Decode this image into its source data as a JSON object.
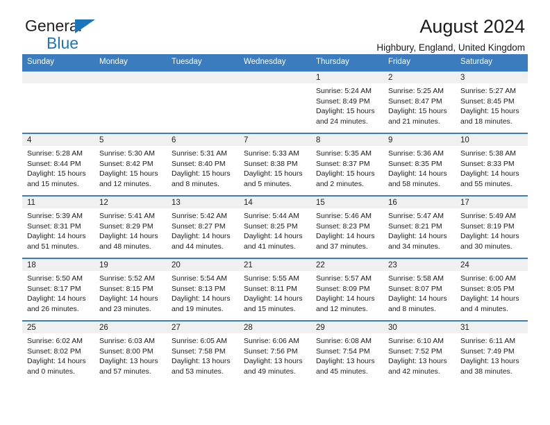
{
  "brand": {
    "line1": "General",
    "line2": "Blue",
    "triangle_color": "#1b75bb",
    "text_color": "#231f20"
  },
  "header": {
    "title": "August 2024",
    "subtitle": "Highbury, England, United Kingdom"
  },
  "theme": {
    "header_blue": "#3a7cbe",
    "daynum_band": "#f0f0f0",
    "text": "#1a1a1a"
  },
  "weekday_headers": [
    "Sunday",
    "Monday",
    "Tuesday",
    "Wednesday",
    "Thursday",
    "Friday",
    "Saturday"
  ],
  "weeks": [
    [
      {
        "day": "",
        "sunrise": "",
        "sunset": "",
        "daylight1": "",
        "daylight2": ""
      },
      {
        "day": "",
        "sunrise": "",
        "sunset": "",
        "daylight1": "",
        "daylight2": ""
      },
      {
        "day": "",
        "sunrise": "",
        "sunset": "",
        "daylight1": "",
        "daylight2": ""
      },
      {
        "day": "",
        "sunrise": "",
        "sunset": "",
        "daylight1": "",
        "daylight2": ""
      },
      {
        "day": "1",
        "sunrise": "Sunrise: 5:24 AM",
        "sunset": "Sunset: 8:49 PM",
        "daylight1": "Daylight: 15 hours",
        "daylight2": "and 24 minutes."
      },
      {
        "day": "2",
        "sunrise": "Sunrise: 5:25 AM",
        "sunset": "Sunset: 8:47 PM",
        "daylight1": "Daylight: 15 hours",
        "daylight2": "and 21 minutes."
      },
      {
        "day": "3",
        "sunrise": "Sunrise: 5:27 AM",
        "sunset": "Sunset: 8:45 PM",
        "daylight1": "Daylight: 15 hours",
        "daylight2": "and 18 minutes."
      }
    ],
    [
      {
        "day": "4",
        "sunrise": "Sunrise: 5:28 AM",
        "sunset": "Sunset: 8:44 PM",
        "daylight1": "Daylight: 15 hours",
        "daylight2": "and 15 minutes."
      },
      {
        "day": "5",
        "sunrise": "Sunrise: 5:30 AM",
        "sunset": "Sunset: 8:42 PM",
        "daylight1": "Daylight: 15 hours",
        "daylight2": "and 12 minutes."
      },
      {
        "day": "6",
        "sunrise": "Sunrise: 5:31 AM",
        "sunset": "Sunset: 8:40 PM",
        "daylight1": "Daylight: 15 hours",
        "daylight2": "and 8 minutes."
      },
      {
        "day": "7",
        "sunrise": "Sunrise: 5:33 AM",
        "sunset": "Sunset: 8:38 PM",
        "daylight1": "Daylight: 15 hours",
        "daylight2": "and 5 minutes."
      },
      {
        "day": "8",
        "sunrise": "Sunrise: 5:35 AM",
        "sunset": "Sunset: 8:37 PM",
        "daylight1": "Daylight: 15 hours",
        "daylight2": "and 2 minutes."
      },
      {
        "day": "9",
        "sunrise": "Sunrise: 5:36 AM",
        "sunset": "Sunset: 8:35 PM",
        "daylight1": "Daylight: 14 hours",
        "daylight2": "and 58 minutes."
      },
      {
        "day": "10",
        "sunrise": "Sunrise: 5:38 AM",
        "sunset": "Sunset: 8:33 PM",
        "daylight1": "Daylight: 14 hours",
        "daylight2": "and 55 minutes."
      }
    ],
    [
      {
        "day": "11",
        "sunrise": "Sunrise: 5:39 AM",
        "sunset": "Sunset: 8:31 PM",
        "daylight1": "Daylight: 14 hours",
        "daylight2": "and 51 minutes."
      },
      {
        "day": "12",
        "sunrise": "Sunrise: 5:41 AM",
        "sunset": "Sunset: 8:29 PM",
        "daylight1": "Daylight: 14 hours",
        "daylight2": "and 48 minutes."
      },
      {
        "day": "13",
        "sunrise": "Sunrise: 5:42 AM",
        "sunset": "Sunset: 8:27 PM",
        "daylight1": "Daylight: 14 hours",
        "daylight2": "and 44 minutes."
      },
      {
        "day": "14",
        "sunrise": "Sunrise: 5:44 AM",
        "sunset": "Sunset: 8:25 PM",
        "daylight1": "Daylight: 14 hours",
        "daylight2": "and 41 minutes."
      },
      {
        "day": "15",
        "sunrise": "Sunrise: 5:46 AM",
        "sunset": "Sunset: 8:23 PM",
        "daylight1": "Daylight: 14 hours",
        "daylight2": "and 37 minutes."
      },
      {
        "day": "16",
        "sunrise": "Sunrise: 5:47 AM",
        "sunset": "Sunset: 8:21 PM",
        "daylight1": "Daylight: 14 hours",
        "daylight2": "and 34 minutes."
      },
      {
        "day": "17",
        "sunrise": "Sunrise: 5:49 AM",
        "sunset": "Sunset: 8:19 PM",
        "daylight1": "Daylight: 14 hours",
        "daylight2": "and 30 minutes."
      }
    ],
    [
      {
        "day": "18",
        "sunrise": "Sunrise: 5:50 AM",
        "sunset": "Sunset: 8:17 PM",
        "daylight1": "Daylight: 14 hours",
        "daylight2": "and 26 minutes."
      },
      {
        "day": "19",
        "sunrise": "Sunrise: 5:52 AM",
        "sunset": "Sunset: 8:15 PM",
        "daylight1": "Daylight: 14 hours",
        "daylight2": "and 23 minutes."
      },
      {
        "day": "20",
        "sunrise": "Sunrise: 5:54 AM",
        "sunset": "Sunset: 8:13 PM",
        "daylight1": "Daylight: 14 hours",
        "daylight2": "and 19 minutes."
      },
      {
        "day": "21",
        "sunrise": "Sunrise: 5:55 AM",
        "sunset": "Sunset: 8:11 PM",
        "daylight1": "Daylight: 14 hours",
        "daylight2": "and 15 minutes."
      },
      {
        "day": "22",
        "sunrise": "Sunrise: 5:57 AM",
        "sunset": "Sunset: 8:09 PM",
        "daylight1": "Daylight: 14 hours",
        "daylight2": "and 12 minutes."
      },
      {
        "day": "23",
        "sunrise": "Sunrise: 5:58 AM",
        "sunset": "Sunset: 8:07 PM",
        "daylight1": "Daylight: 14 hours",
        "daylight2": "and 8 minutes."
      },
      {
        "day": "24",
        "sunrise": "Sunrise: 6:00 AM",
        "sunset": "Sunset: 8:05 PM",
        "daylight1": "Daylight: 14 hours",
        "daylight2": "and 4 minutes."
      }
    ],
    [
      {
        "day": "25",
        "sunrise": "Sunrise: 6:02 AM",
        "sunset": "Sunset: 8:02 PM",
        "daylight1": "Daylight: 14 hours",
        "daylight2": "and 0 minutes."
      },
      {
        "day": "26",
        "sunrise": "Sunrise: 6:03 AM",
        "sunset": "Sunset: 8:00 PM",
        "daylight1": "Daylight: 13 hours",
        "daylight2": "and 57 minutes."
      },
      {
        "day": "27",
        "sunrise": "Sunrise: 6:05 AM",
        "sunset": "Sunset: 7:58 PM",
        "daylight1": "Daylight: 13 hours",
        "daylight2": "and 53 minutes."
      },
      {
        "day": "28",
        "sunrise": "Sunrise: 6:06 AM",
        "sunset": "Sunset: 7:56 PM",
        "daylight1": "Daylight: 13 hours",
        "daylight2": "and 49 minutes."
      },
      {
        "day": "29",
        "sunrise": "Sunrise: 6:08 AM",
        "sunset": "Sunset: 7:54 PM",
        "daylight1": "Daylight: 13 hours",
        "daylight2": "and 45 minutes."
      },
      {
        "day": "30",
        "sunrise": "Sunrise: 6:10 AM",
        "sunset": "Sunset: 7:52 PM",
        "daylight1": "Daylight: 13 hours",
        "daylight2": "and 42 minutes."
      },
      {
        "day": "31",
        "sunrise": "Sunrise: 6:11 AM",
        "sunset": "Sunset: 7:49 PM",
        "daylight1": "Daylight: 13 hours",
        "daylight2": "and 38 minutes."
      }
    ]
  ]
}
